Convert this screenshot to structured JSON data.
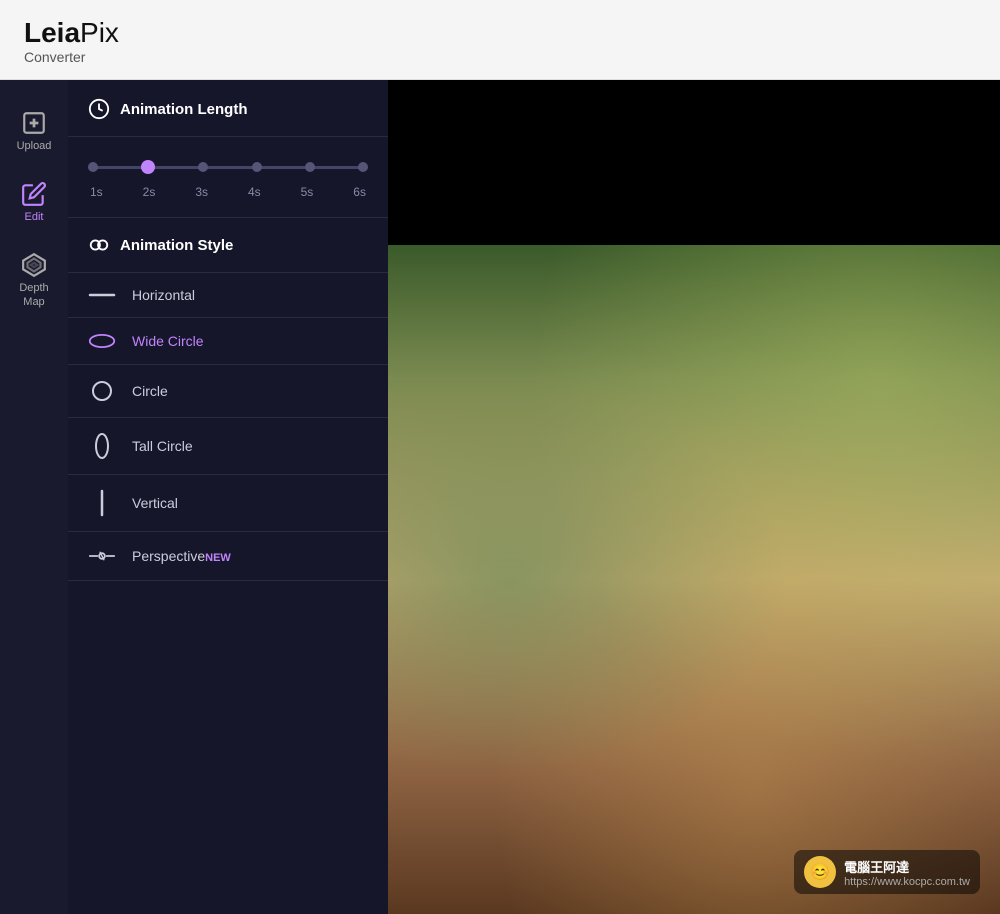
{
  "app": {
    "title_bold": "Leia",
    "title_light": "Pix",
    "subtitle": "Converter"
  },
  "sidebar": {
    "items": [
      {
        "id": "upload",
        "label": "Upload",
        "active": false
      },
      {
        "id": "edit",
        "label": "Edit",
        "active": true
      },
      {
        "id": "depth-map",
        "label": "Depth\nMap",
        "active": false
      }
    ]
  },
  "panel": {
    "animation_length": {
      "section_title": "Animation Length",
      "slider_values": [
        "1s",
        "2s",
        "3s",
        "4s",
        "5s",
        "6s"
      ],
      "active_index": 1
    },
    "animation_style": {
      "section_title": "Animation Style",
      "items": [
        {
          "id": "horizontal",
          "label": "Horizontal",
          "icon": "horizontal-line",
          "active": false
        },
        {
          "id": "wide-circle",
          "label": "Wide Circle",
          "icon": "wide-circle",
          "active": true
        },
        {
          "id": "circle",
          "label": "Circle",
          "icon": "circle",
          "active": false
        },
        {
          "id": "tall-circle",
          "label": "Tall Circle",
          "icon": "tall-circle",
          "active": false
        },
        {
          "id": "vertical",
          "label": "Vertical",
          "icon": "vertical-line",
          "active": false
        },
        {
          "id": "perspective",
          "label": "Perspective",
          "icon": "perspective",
          "active": false,
          "badge": "NEW"
        }
      ]
    }
  }
}
